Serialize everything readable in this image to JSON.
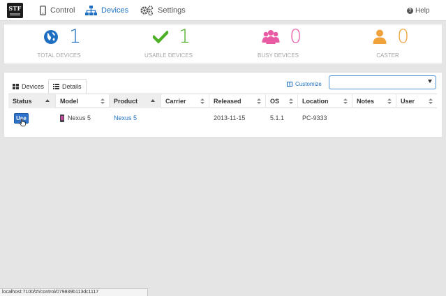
{
  "nav": {
    "logo_text": "STF",
    "items": [
      {
        "label": "Control",
        "icon": "mobile-icon"
      },
      {
        "label": "Devices",
        "icon": "sitemap-icon"
      },
      {
        "label": "Settings",
        "icon": "gears-icon"
      }
    ],
    "help_label": "Help"
  },
  "stats": [
    {
      "value": "1",
      "label": "TOTAL DEVICES",
      "color": "#1e6fc1",
      "icon": "globe-icon"
    },
    {
      "value": "1",
      "label": "USABLE DEVICES",
      "color": "#4caf26",
      "icon": "check-icon"
    },
    {
      "value": "0",
      "label": "BUSY DEVICES",
      "color": "#e85aa3",
      "icon": "users-icon"
    },
    {
      "value": "0",
      "label": "CASTER",
      "color": "#f0a23a",
      "icon": "user-icon"
    }
  ],
  "tabs": {
    "devices_label": "Devices",
    "details_label": "Details",
    "customize_label": "Customize"
  },
  "search": {
    "value": ""
  },
  "table": {
    "columns": [
      "Status",
      "Model",
      "Product",
      "Carrier",
      "Released",
      "OS",
      "Location",
      "Notes",
      "User"
    ],
    "rows": [
      {
        "status": "Use",
        "model": "Nexus 5",
        "product": "Nexus 5",
        "carrier": "",
        "released": "2013-11-15",
        "os": "5.1.1",
        "location": "PC-9333",
        "notes": "",
        "user": ""
      }
    ]
  },
  "statusbar": {
    "url": "localhost:7100/#!/control/079839b113dc1117"
  }
}
